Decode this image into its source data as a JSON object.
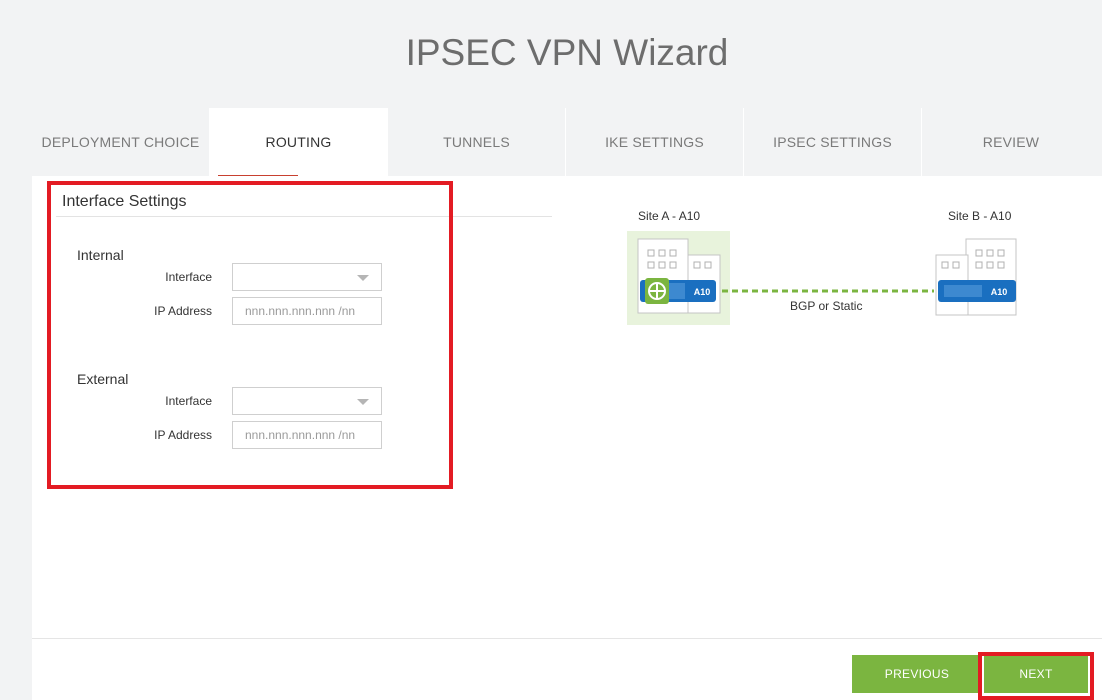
{
  "title": "IPSEC VPN Wizard",
  "tabs": [
    {
      "label": "DEPLOYMENT CHOICE"
    },
    {
      "label": "ROUTING"
    },
    {
      "label": "TUNNELS"
    },
    {
      "label": "IKE SETTINGS"
    },
    {
      "label": "IPSEC SETTINGS"
    },
    {
      "label": "REVIEW"
    }
  ],
  "interface_settings": {
    "title": "Interface Settings",
    "internal": {
      "label": "Internal",
      "interface_label": "Interface",
      "interface_value": "",
      "ip_label": "IP Address",
      "ip_placeholder": "nnn.nnn.nnn.nnn /nn"
    },
    "external": {
      "label": "External",
      "interface_label": "Interface",
      "interface_value": "",
      "ip_label": "IP Address",
      "ip_placeholder": "nnn.nnn.nnn.nnn /nn"
    }
  },
  "diagram": {
    "site_a": "Site A - A10",
    "site_b": "Site B - A10",
    "connection": "BGP or Static",
    "device_logo": "A10",
    "colors": {
      "link": "#7bb540",
      "device": "#1a6fc0",
      "router": "#7bb540"
    }
  },
  "buttons": {
    "previous": "PREVIOUS",
    "next": "NEXT"
  },
  "colors": {
    "accent": "#7bb540",
    "highlight": "#e31b23"
  }
}
